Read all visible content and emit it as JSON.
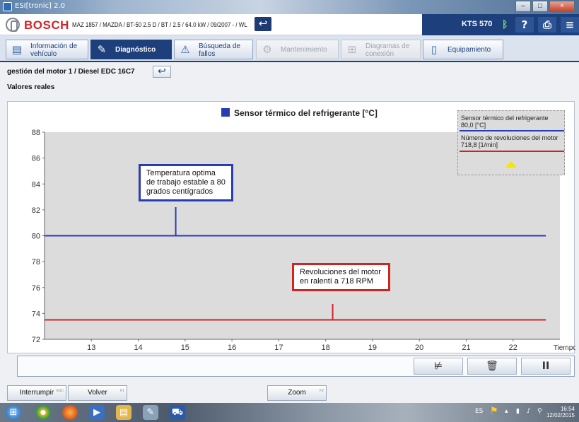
{
  "window": {
    "title": "ESI[tronic] 2.0"
  },
  "header": {
    "brand": "BOSCH",
    "vehicle": "MAZ 1857 / MAZDA / BT-50 2.5 D / BT / 2.5 / 64.0 kW / 09/2007 - / WL",
    "device": "KTS 570",
    "icons": {
      "back": "back-arrow-icon",
      "bluetooth": "bluetooth-icon",
      "help": "help-icon",
      "print": "print-icon",
      "menu": "menu-icon"
    }
  },
  "tabs": [
    {
      "label": "Información de\nvehículo",
      "icon": "vehicle-info-icon",
      "state": "normal"
    },
    {
      "label": "Diagnóstico",
      "icon": "diagnosis-icon",
      "state": "active"
    },
    {
      "label": "Búsqueda de\nfallos",
      "icon": "troubleshooting-icon",
      "state": "normal"
    },
    {
      "label": "Mantenimiento",
      "icon": "maintenance-icon",
      "state": "disabled"
    },
    {
      "label": "Diagramas de\nconexión",
      "icon": "wiring-icon",
      "state": "disabled"
    },
    {
      "label": "Equipamiento",
      "icon": "equipment-icon",
      "state": "normal"
    }
  ],
  "path": {
    "text": "gestión del motor 1 / Diesel EDC 16C7"
  },
  "subtitle": "Valores reales",
  "chart_data": {
    "type": "line",
    "title": "Sensor térmico del refrigerante [°C]",
    "xlabel": "Tiempo [s]",
    "ylabel": "",
    "xlim": [
      12,
      23
    ],
    "ylim": [
      72,
      88
    ],
    "x_ticks": [
      13,
      14,
      15,
      16,
      17,
      18,
      19,
      20,
      21,
      22
    ],
    "y_ticks": [
      72,
      74,
      76,
      78,
      80,
      82,
      84,
      86,
      88
    ],
    "grid": false,
    "series": [
      {
        "name": "Sensor térmico del refrigerante",
        "color": "#2a3db0",
        "x": [
          12,
          22.7
        ],
        "y": [
          80,
          80
        ],
        "axis": "left"
      },
      {
        "name": "Número de revoluciones del motor",
        "color": "#d02424",
        "x": [
          12,
          22.7
        ],
        "y": [
          73.5,
          73.5
        ],
        "axis": "none"
      }
    ],
    "legend": [
      {
        "name": "Sensor térmico del refrigerante",
        "value": "80,0 [°C]",
        "color": "#2a3db0"
      },
      {
        "name": "Número de revoluciones del motor",
        "value": "718,8 [1/min]",
        "color": "#d02424"
      }
    ],
    "legend_position": "top-right",
    "annotations": [
      {
        "text": "Temperatura optima de trabajo estable a 80 grados centígrados",
        "color": "#2a3db0",
        "x": 14.8,
        "y": 80
      },
      {
        "text": "Revoluciones del motor en ralentí a 718 RPM",
        "color": "#d02424",
        "x": 18.15,
        "y": 73.5
      }
    ]
  },
  "controls": {
    "icons": [
      "chart-settings-icon",
      "delete-icon",
      "pause-icon"
    ]
  },
  "bottom_buttons": {
    "interrumpir": "Interrumpir",
    "interrumpir_key": "ESC",
    "volver": "Volver",
    "volver_key": "F1",
    "zoom": "Zoom",
    "zoom_key": "F2"
  },
  "taskbar": {
    "language": "ES",
    "time": "16:54",
    "date": "12/02/2015",
    "apps": [
      "start-icon",
      "chrome-icon",
      "firefox-icon",
      "media-icon",
      "explorer-icon",
      "tool-icon",
      "esitronic-icon"
    ]
  }
}
